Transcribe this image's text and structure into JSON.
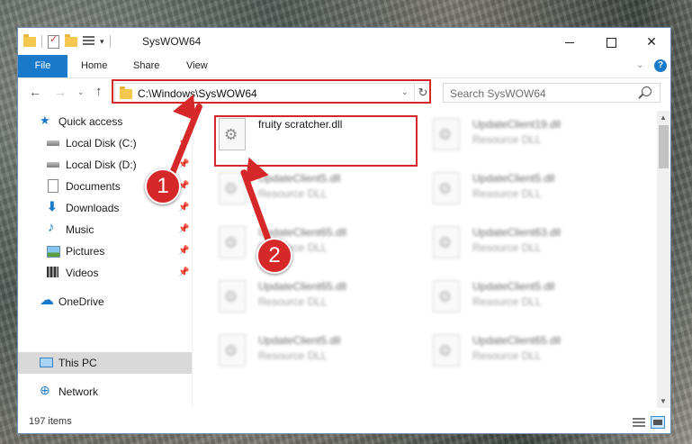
{
  "window": {
    "title": "SysWOW64",
    "minimize_glyph": "",
    "close_glyph": "✕"
  },
  "ribbon": {
    "tabs": [
      "File",
      "Home",
      "Share",
      "View"
    ]
  },
  "nav": {
    "address": "C:\\Windows\\SysWOW64",
    "search_placeholder": "Search SysWOW64"
  },
  "sidebar": {
    "items": [
      {
        "label": "Quick access",
        "icon": "star-icon"
      },
      {
        "label": "Local Disk (C:)",
        "icon": "drive-icon"
      },
      {
        "label": "Local Disk (D:)",
        "icon": "drive-icon"
      },
      {
        "label": "Documents",
        "icon": "documents-icon"
      },
      {
        "label": "Downloads",
        "icon": "download-icon"
      },
      {
        "label": "Music",
        "icon": "music-icon"
      },
      {
        "label": "Pictures",
        "icon": "pictures-icon"
      },
      {
        "label": "Videos",
        "icon": "videos-icon"
      },
      {
        "label": "OneDrive",
        "icon": "cloud-icon"
      },
      {
        "label": "This PC",
        "icon": "computer-icon"
      },
      {
        "label": "Network",
        "icon": "network-icon"
      }
    ]
  },
  "files": [
    {
      "name": "fruity scratcher.dll",
      "type": ""
    },
    {
      "name": "UpdateClient19.dll",
      "type": "Resource DLL"
    },
    {
      "name": "UpdateClient5.dll",
      "type": "Resource DLL"
    },
    {
      "name": "UpdateClient5.dll",
      "type": "Resource DLL"
    },
    {
      "name": "UpdateClient65.dll",
      "type": "Resource DLL"
    },
    {
      "name": "UpdateClient63.dll",
      "type": "Resource DLL"
    },
    {
      "name": "UpdateClient65.dll",
      "type": "Resource DLL"
    },
    {
      "name": "UpdateClient5.dll",
      "type": "Resource DLL"
    },
    {
      "name": "UpdateClient5.dll",
      "type": "Resource DLL"
    },
    {
      "name": "UpdateClient65.dll",
      "type": "Resource DLL"
    }
  ],
  "status": {
    "item_count": "197 items"
  },
  "annotations": {
    "step1": "1",
    "step2": "2",
    "color": "#d62828"
  }
}
